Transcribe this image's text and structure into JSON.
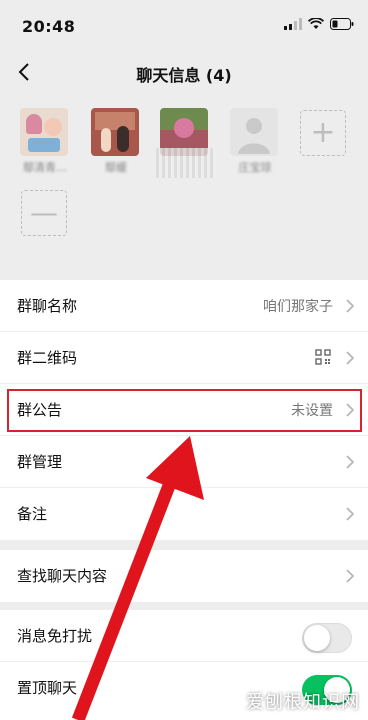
{
  "status": {
    "time": "20:48"
  },
  "nav": {
    "title": "聊天信息 (4)"
  },
  "members": [
    {
      "name": "鄢清青…",
      "avatar_color": "#e8d9d0"
    },
    {
      "name": "鄢缓",
      "avatar_color": "#c96b5c"
    },
    {
      "name": "",
      "avatar_color": "#7c8f5a"
    },
    {
      "name": "庄宝琼",
      "avatar_color": "#e2e2e2"
    }
  ],
  "actions": {
    "add_icon": "plus-icon",
    "remove_icon": "minus-icon"
  },
  "settings": {
    "group_name": {
      "label": "群聊名称",
      "value": "咱们那家子"
    },
    "qr_code": {
      "label": "群二维码"
    },
    "announcement": {
      "label": "群公告",
      "value": "未设置"
    },
    "manage": {
      "label": "群管理"
    },
    "remark": {
      "label": "备注"
    },
    "search": {
      "label": "查找聊天内容"
    },
    "mute": {
      "label": "消息免打扰",
      "enabled": false
    },
    "pin": {
      "label": "置顶聊天",
      "enabled": true
    }
  },
  "annotation": {
    "highlight_color": "#d6232f"
  },
  "watermark": "爱刨根知识网"
}
